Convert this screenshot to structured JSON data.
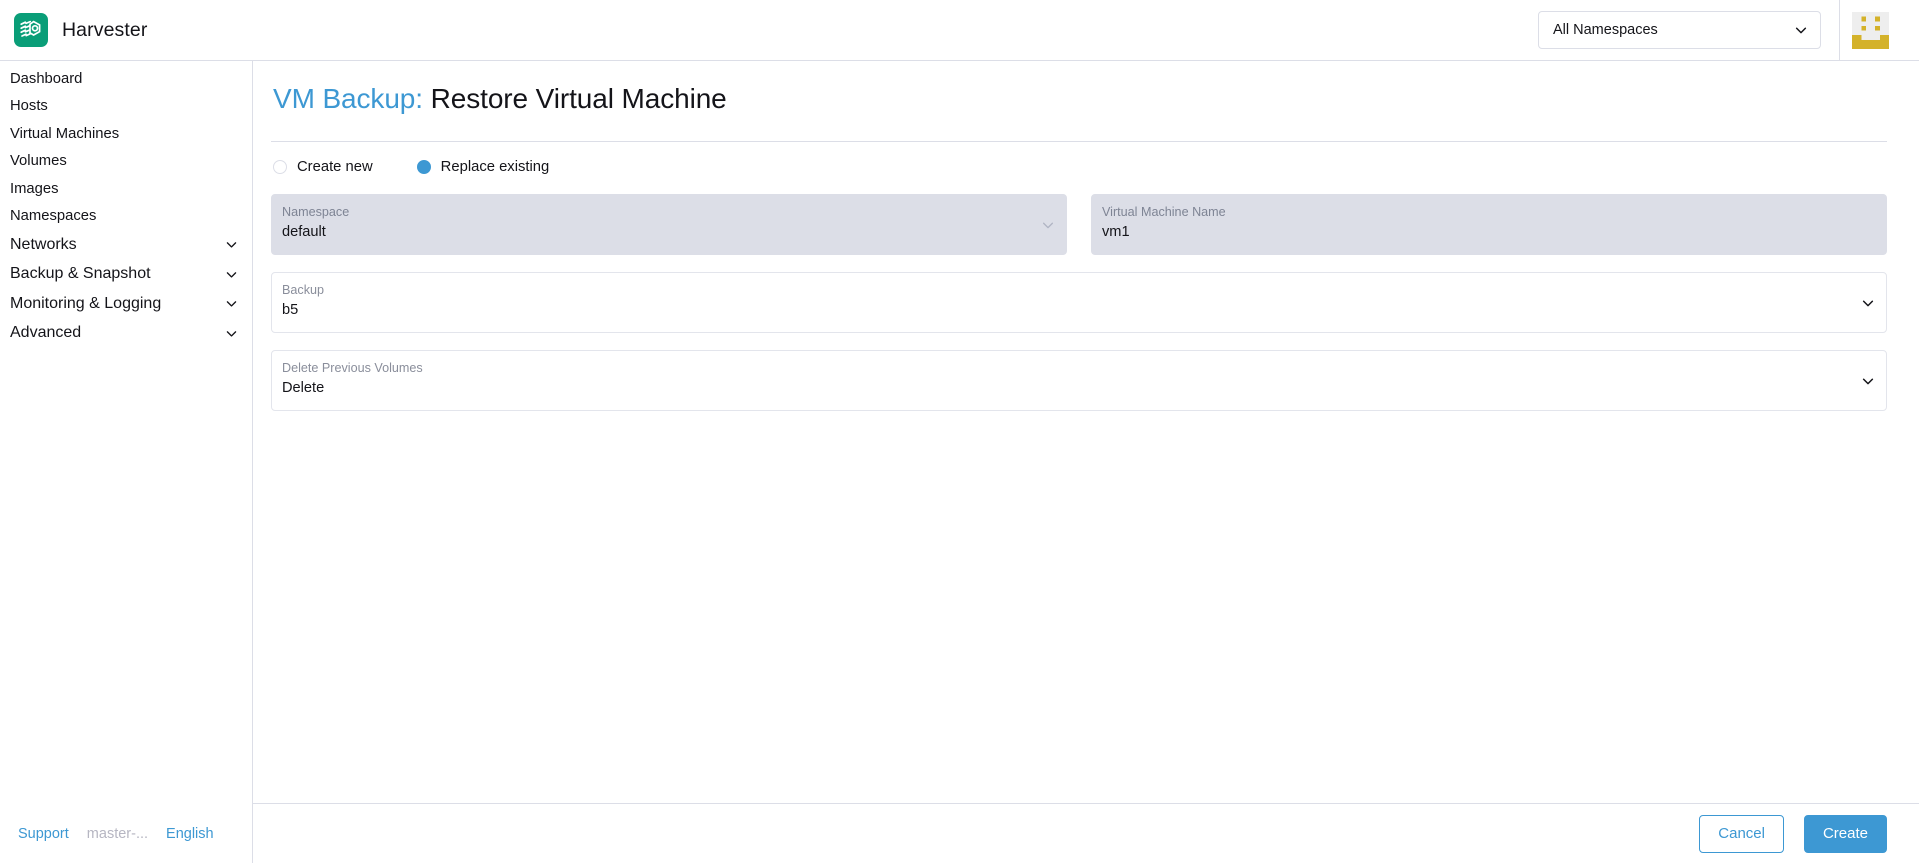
{
  "header": {
    "brand_name": "Harvester",
    "logo_icon": "harvester-logo-icon",
    "namespace_selector": {
      "value": "All Namespaces",
      "chevron_icon": "chevron-down-icon"
    },
    "avatar_icon": "user-avatar-identicon"
  },
  "sidebar": {
    "items": [
      {
        "label": "Dashboard",
        "expandable": false
      },
      {
        "label": "Hosts",
        "expandable": false
      },
      {
        "label": "Virtual Machines",
        "expandable": false
      },
      {
        "label": "Volumes",
        "expandable": false
      },
      {
        "label": "Images",
        "expandable": false
      },
      {
        "label": "Namespaces",
        "expandable": false
      },
      {
        "label": "Networks",
        "expandable": true
      },
      {
        "label": "Backup & Snapshot",
        "expandable": true
      },
      {
        "label": "Monitoring & Logging",
        "expandable": true
      },
      {
        "label": "Advanced",
        "expandable": true
      }
    ],
    "footer": {
      "support_label": "Support",
      "version_label": "master-...",
      "language_label": "English"
    }
  },
  "page": {
    "title_prefix": "VM Backup:",
    "title_suffix": "Restore Virtual Machine",
    "restore_mode": {
      "options": [
        {
          "label": "Create new",
          "selected": false
        },
        {
          "label": "Replace existing",
          "selected": true
        }
      ]
    },
    "fields": [
      {
        "name": "namespace",
        "label": "Namespace",
        "value": "default",
        "disabled": true,
        "chevron_icon": "chevron-down-icon"
      },
      {
        "name": "virtual-machine-name",
        "label": "Virtual Machine Name",
        "value": "vm1",
        "disabled": true,
        "chevron_icon": null
      },
      {
        "name": "backup",
        "label": "Backup",
        "value": "b5",
        "disabled": false,
        "chevron_icon": "chevron-down-icon"
      },
      {
        "name": "delete-previous-volumes",
        "label": "Delete Previous Volumes",
        "value": "Delete",
        "disabled": false,
        "chevron_icon": "chevron-down-icon"
      }
    ]
  },
  "actions": {
    "cancel_label": "Cancel",
    "create_label": "Create"
  },
  "colors": {
    "accent_blue": "#3d98d3",
    "brand_green": "#0a9e78",
    "border_gray": "#dcdee7",
    "disabled_field": "#dcdee7",
    "avatar_gold": "#d4b22a"
  }
}
